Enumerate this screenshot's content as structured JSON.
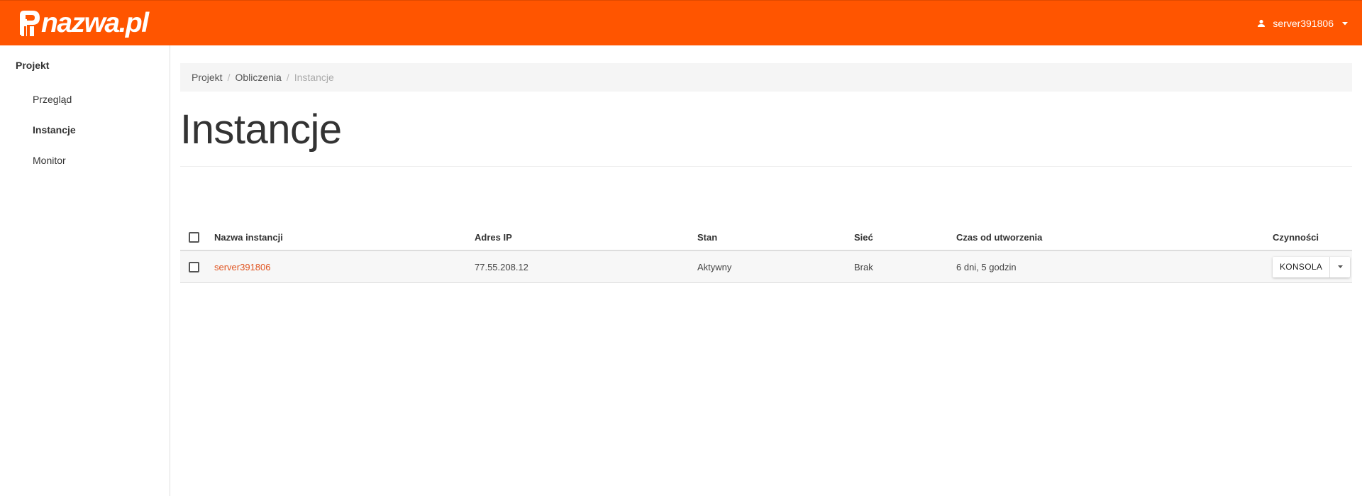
{
  "brand": {
    "name": "nazwa.pl",
    "color": "#ff5500"
  },
  "user_menu": {
    "username": "server391806",
    "icon": "user-icon",
    "caret": "caret-down-icon"
  },
  "sidebar": {
    "section": "Projekt",
    "items": [
      {
        "label": "Przegląd",
        "active": false
      },
      {
        "label": "Instancje",
        "active": true
      },
      {
        "label": "Monitor",
        "active": false
      }
    ]
  },
  "breadcrumb": {
    "items": [
      "Projekt",
      "Obliczenia"
    ],
    "current": "Instancje"
  },
  "page": {
    "title": "Instancje"
  },
  "table": {
    "columns": {
      "name": "Nazwa instancji",
      "ip": "Adres IP",
      "state": "Stan",
      "network": "Sieć",
      "age": "Czas od utworzenia",
      "actions": "Czynności"
    },
    "rows": [
      {
        "name": "server391806",
        "ip": "77.55.208.12",
        "state": "Aktywny",
        "network": "Brak",
        "age": "6 dni, 5 godzin",
        "action_label": "KONSOLA"
      }
    ]
  },
  "colors": {
    "accent": "#ff5500",
    "link": "#e0531f"
  }
}
